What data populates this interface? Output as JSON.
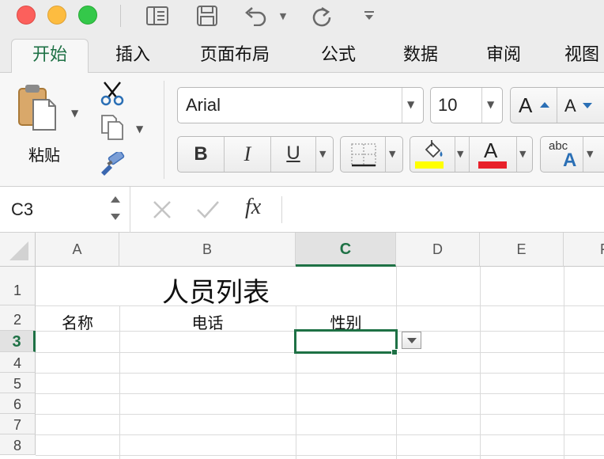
{
  "toolbar": {
    "icons": [
      "sidebar-toggle-icon",
      "save-icon",
      "undo-icon",
      "redo-icon",
      "customize-toolbar-icon"
    ]
  },
  "tabs": [
    {
      "label": "开始",
      "active": true
    },
    {
      "label": "插入"
    },
    {
      "label": "页面布局"
    },
    {
      "label": "公式"
    },
    {
      "label": "数据"
    },
    {
      "label": "审阅"
    },
    {
      "label": "视图"
    }
  ],
  "ribbon": {
    "paste_label": "粘贴",
    "font_name": "Arial",
    "font_size": "10",
    "bold_label": "B",
    "italic_label": "I",
    "underline_label": "U",
    "increase_font_label": "A",
    "decrease_font_label": "A",
    "font_color_label": "A",
    "text_style_label": "abc",
    "text_style_letter": "A",
    "highlight_color": "#ffff00",
    "font_color": "#e8202a"
  },
  "formula_bar": {
    "name_box": "C3",
    "fx_label": "fx"
  },
  "sheet": {
    "columns": [
      "A",
      "B",
      "C",
      "D",
      "E",
      "F"
    ],
    "rows": [
      "1",
      "2",
      "3",
      "4",
      "5",
      "6",
      "7",
      "8"
    ],
    "selected_cell": "C3",
    "title": "人员列表",
    "headers": [
      "名称",
      "电话",
      "性别"
    ]
  },
  "colors": {
    "accent": "#1e7145"
  }
}
